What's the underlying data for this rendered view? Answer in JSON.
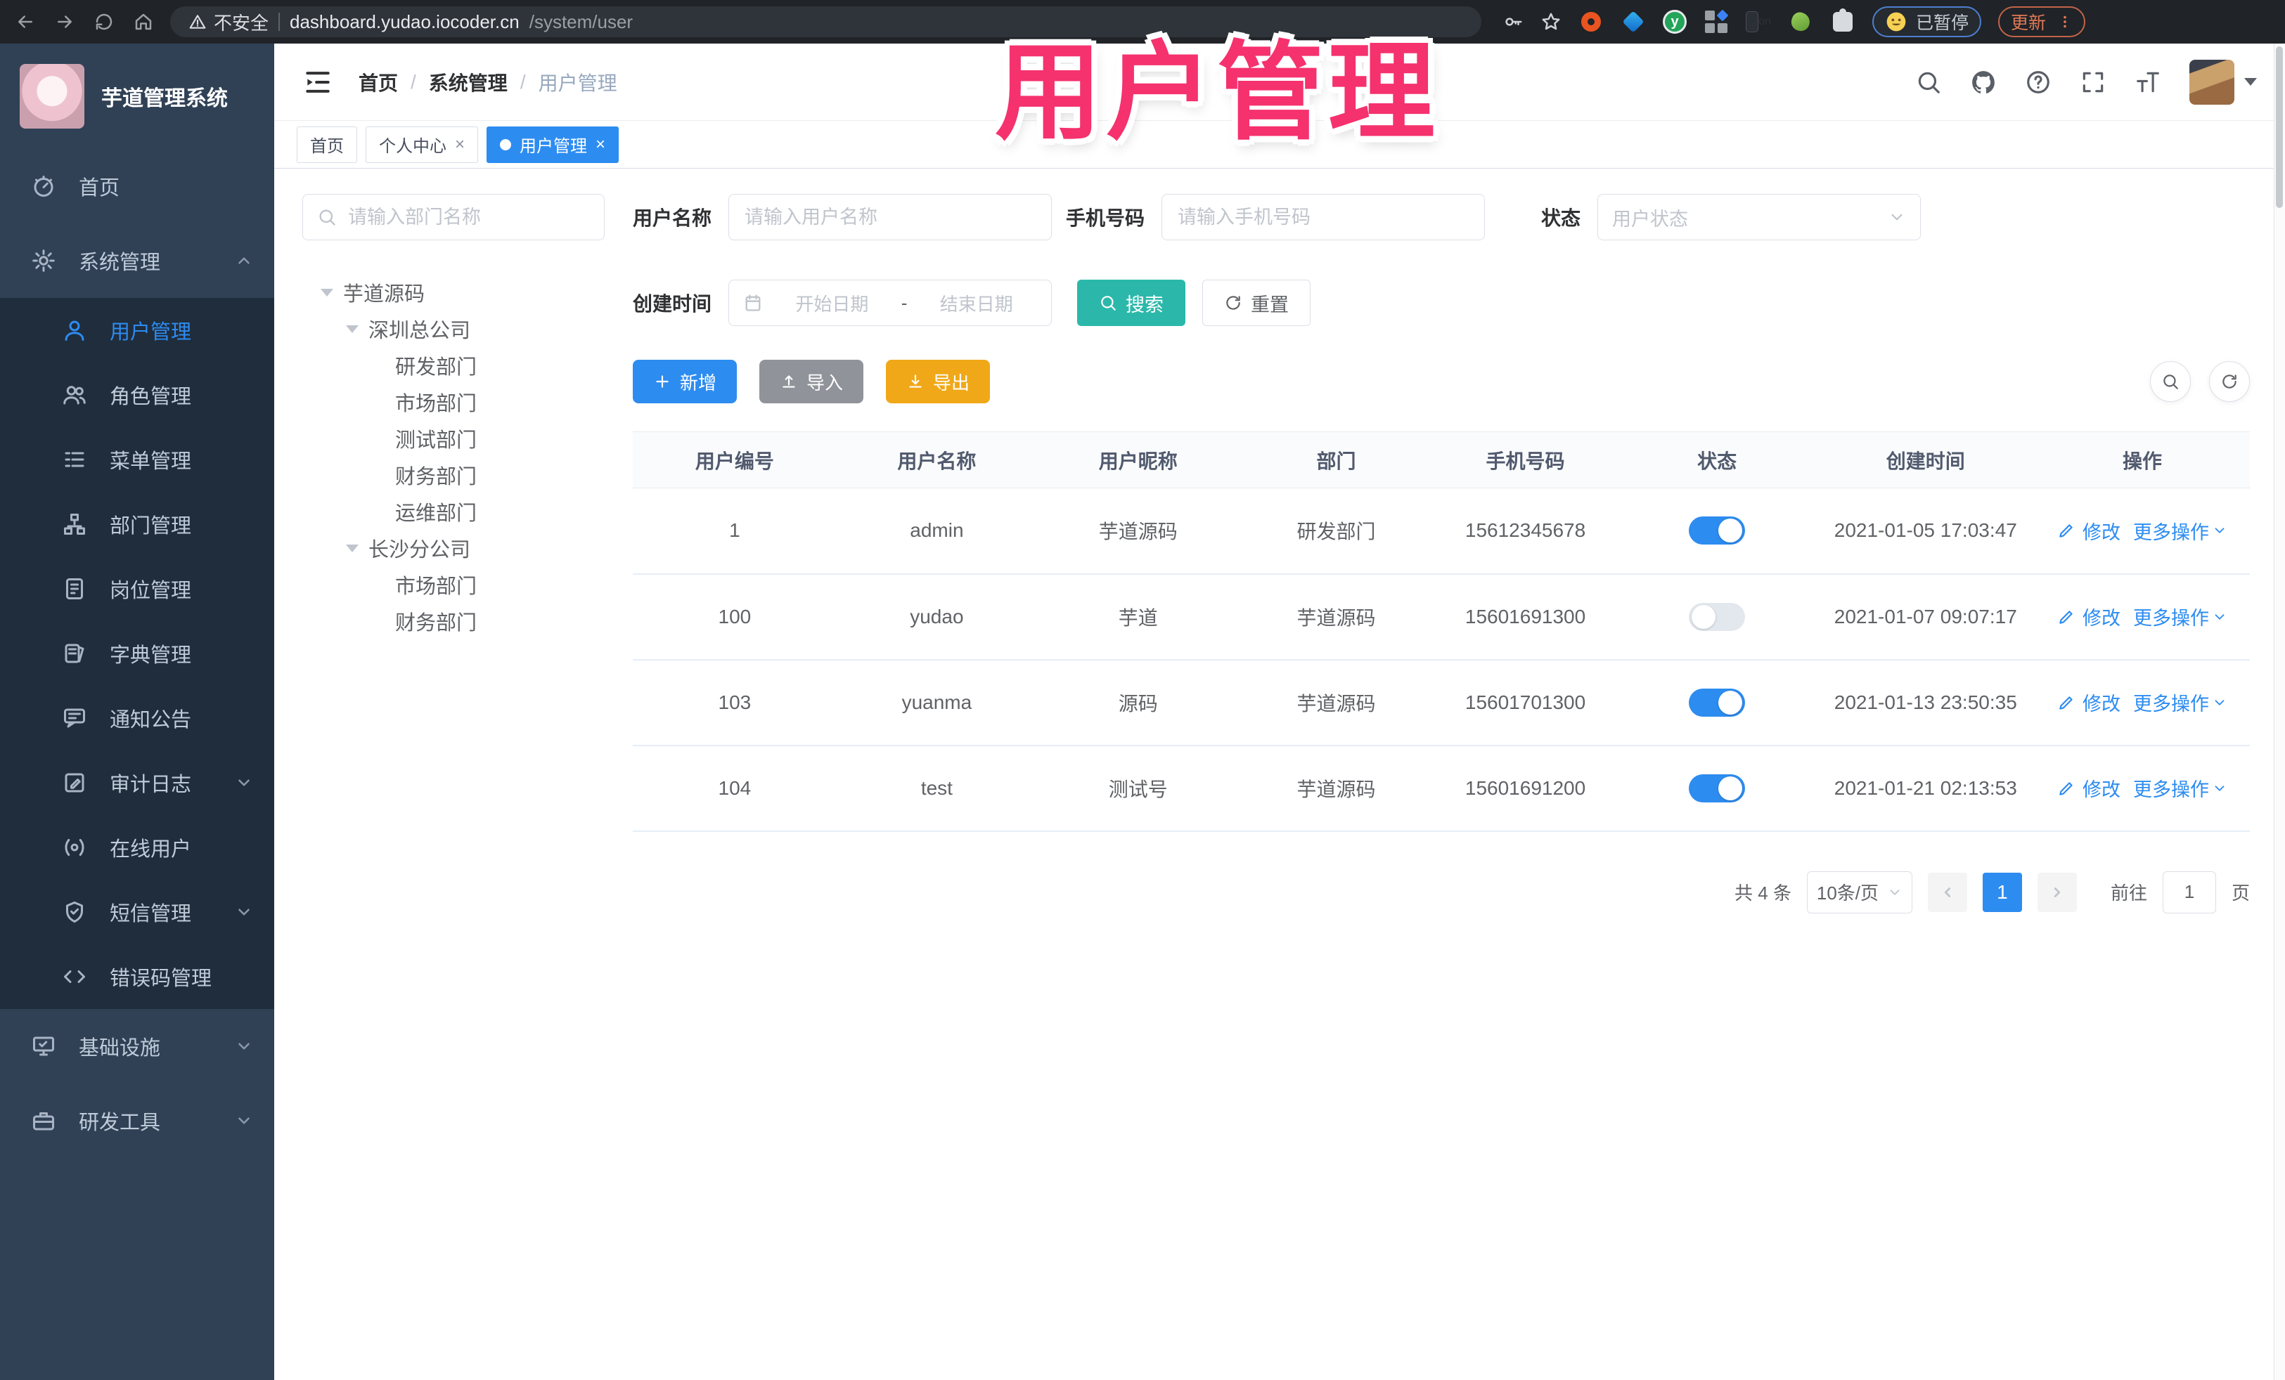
{
  "browser": {
    "security_label": "不安全",
    "url_host": "dashboard.yudao.iocoder.cn",
    "url_path": "/system/user",
    "ext_on_badge": "on",
    "ext_y_logo": "y",
    "paused_label": "已暂停",
    "update_label": "更新"
  },
  "overlay": {
    "title": "用户管理"
  },
  "sidebar": {
    "app_title": "芋道管理系统",
    "home": "首页",
    "system": "系统管理",
    "sub": [
      "用户管理",
      "角色管理",
      "菜单管理",
      "部门管理",
      "岗位管理",
      "字典管理",
      "通知公告",
      "审计日志",
      "在线用户",
      "短信管理",
      "错误码管理"
    ],
    "infra": "基础设施",
    "dev": "研发工具"
  },
  "header": {
    "breadcrumb": [
      "首页",
      "系统管理",
      "用户管理"
    ],
    "separator": "/"
  },
  "tabs": {
    "items": [
      "首页",
      "个人中心",
      "用户管理"
    ],
    "close_glyph": "×"
  },
  "tree": {
    "search_placeholder": "请输入部门名称",
    "root": "芋道源码",
    "b1": "深圳总公司",
    "b1c": [
      "研发部门",
      "市场部门",
      "测试部门",
      "财务部门",
      "运维部门"
    ],
    "b2": "长沙分公司",
    "b2c": [
      "市场部门",
      "财务部门"
    ]
  },
  "filters": {
    "username_label": "用户名称",
    "username_placeholder": "请输入用户名称",
    "mobile_label": "手机号码",
    "mobile_placeholder": "请输入手机号码",
    "status_label": "状态",
    "status_placeholder": "用户状态",
    "created_label": "创建时间",
    "date_start_placeholder": "开始日期",
    "date_separator": "-",
    "date_end_placeholder": "结束日期",
    "search_label": "搜索",
    "reset_label": "重置"
  },
  "toolbar": {
    "add_label": "新增",
    "import_label": "导入",
    "export_label": "导出"
  },
  "table": {
    "columns": [
      "用户编号",
      "用户名称",
      "用户昵称",
      "部门",
      "手机号码",
      "状态",
      "创建时间",
      "操作"
    ],
    "edit_label": "修改",
    "more_label": "更多操作",
    "rows": [
      {
        "id": "1",
        "username": "admin",
        "nickname": "芋道源码",
        "dept": "研发部门",
        "mobile": "15612345678",
        "enabled": true,
        "created": "2021-01-05 17:03:47"
      },
      {
        "id": "100",
        "username": "yudao",
        "nickname": "芋道",
        "dept": "芋道源码",
        "mobile": "15601691300",
        "enabled": false,
        "created": "2021-01-07 09:07:17"
      },
      {
        "id": "103",
        "username": "yuanma",
        "nickname": "源码",
        "dept": "芋道源码",
        "mobile": "15601701300",
        "enabled": true,
        "created": "2021-01-13 23:50:35"
      },
      {
        "id": "104",
        "username": "test",
        "nickname": "测试号",
        "dept": "芋道源码",
        "mobile": "15601691200",
        "enabled": true,
        "created": "2021-01-21 02:13:53"
      }
    ]
  },
  "pagination": {
    "total": "共 4 条",
    "page_size": "10条/页",
    "current": "1",
    "goto_label": "前往",
    "goto_value": "1",
    "page_unit": "页"
  },
  "colors": {
    "accent": "#2d8cf0",
    "search_teal": "#2bb8aa",
    "export_yellow": "#f0a818",
    "import_gray": "#909399",
    "sidebar_bg": "#304156",
    "submenu_bg": "#1f2d3d",
    "overlay_pink": "#f5316e"
  }
}
